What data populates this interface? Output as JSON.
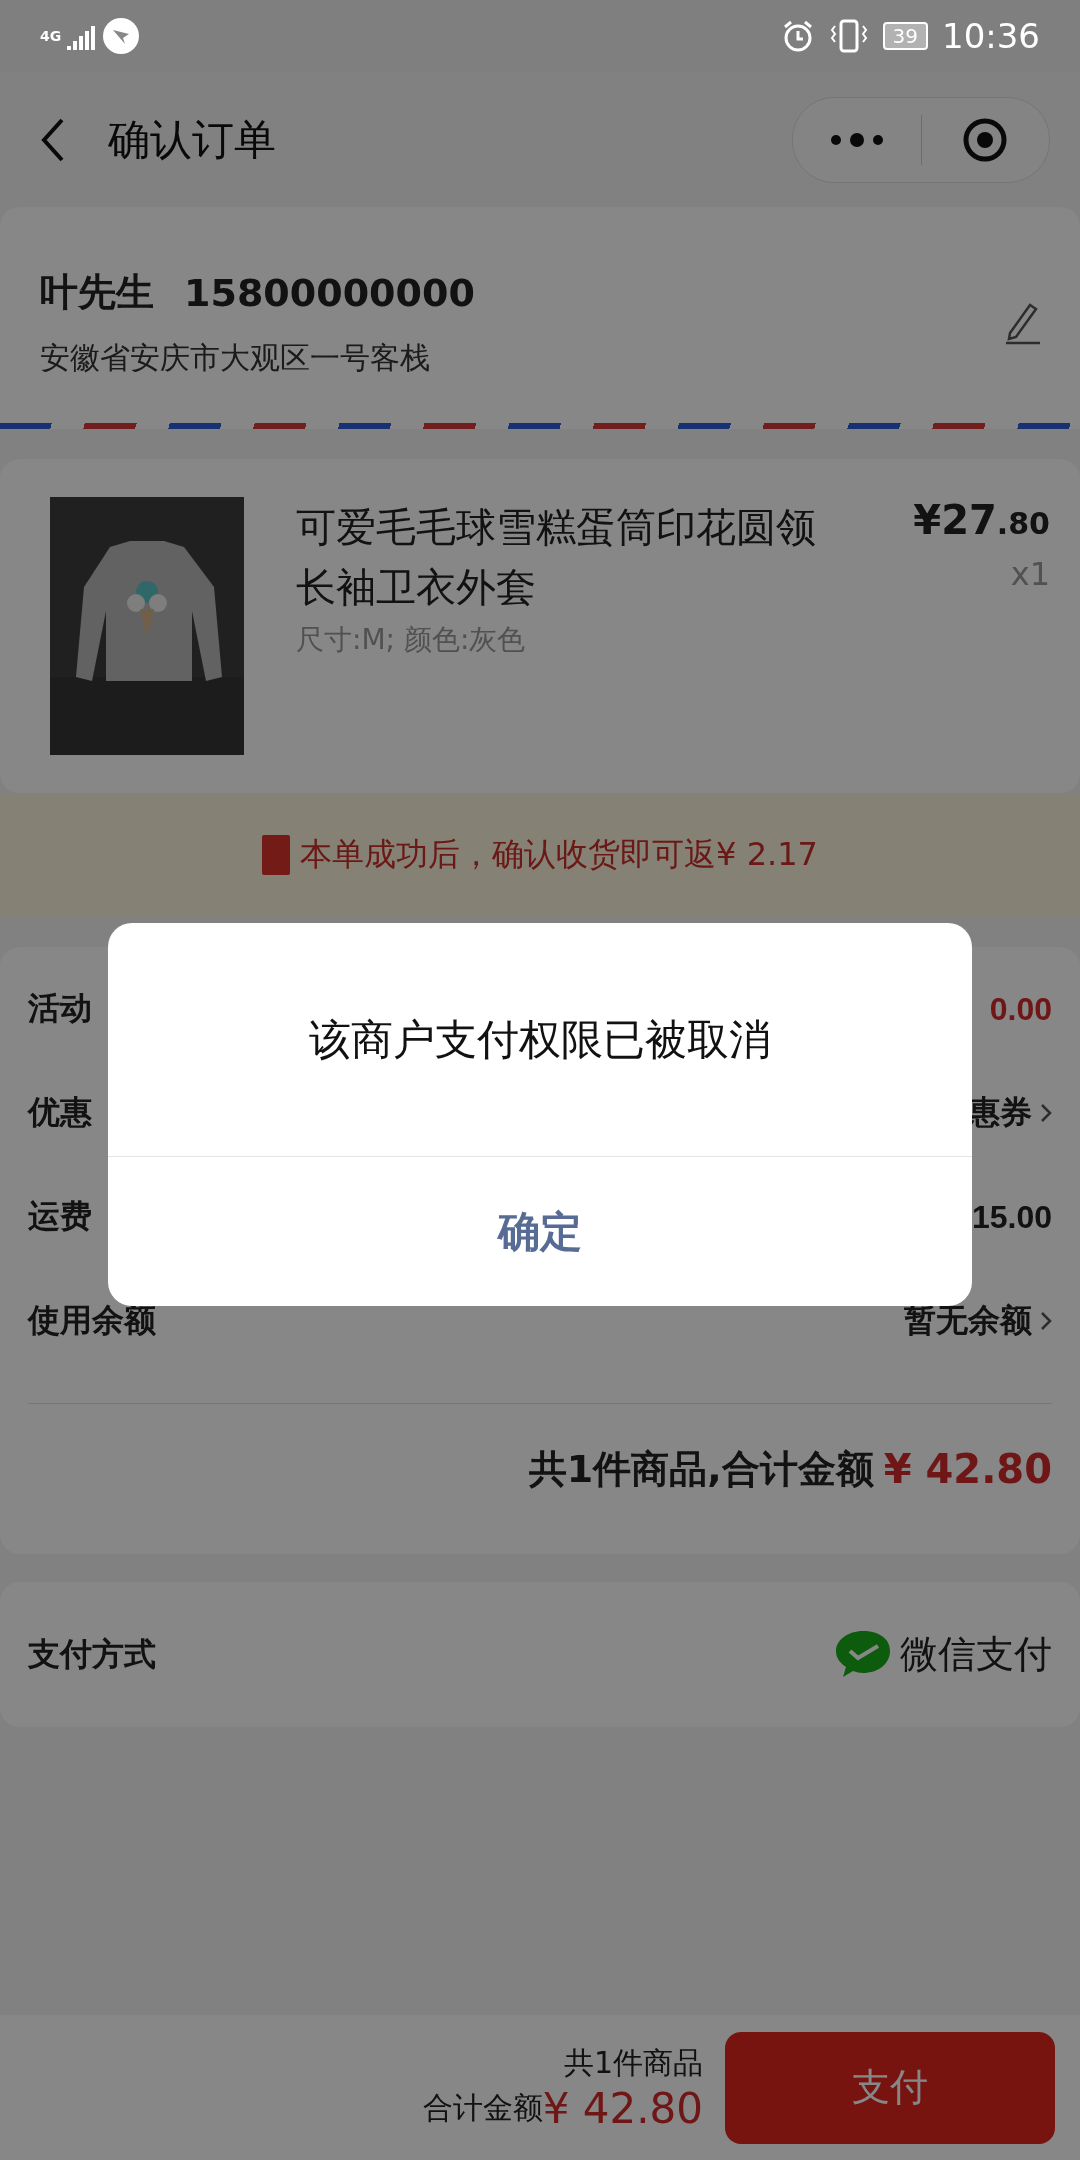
{
  "status_bar": {
    "network": "4G",
    "battery": "39",
    "time": "10:36"
  },
  "header": {
    "title": "确认订单"
  },
  "address": {
    "name": "叶先生",
    "phone": "15800000000",
    "address": "安徽省安庆市大观区一号客栈"
  },
  "product": {
    "title": "可爱毛毛球雪糕蛋筒印花圆领长袖卫衣外套",
    "specs": "尺寸:M; 颜色:灰色",
    "price": "¥27",
    "price_decimal": ".80",
    "quantity": "x1"
  },
  "rebate": {
    "text": "本单成功后，确认收货即可返¥ 2.17"
  },
  "summary": {
    "rows": [
      {
        "label": "活动",
        "value": "0.00",
        "accent": true,
        "chevron": false
      },
      {
        "label": "优惠",
        "value": "惠券",
        "accent": false,
        "chevron": true
      },
      {
        "label": "运费",
        "value": "15.00",
        "accent": false,
        "chevron": false
      },
      {
        "label": "使用余额",
        "value": "暂无余额",
        "accent": false,
        "chevron": true
      }
    ],
    "total_label": "共1件商品,合计金额",
    "total_amount": "¥ 42.80"
  },
  "payment": {
    "label": "支付方式",
    "method": "微信支付"
  },
  "footer": {
    "count": "共1件商品",
    "label": "合计金额",
    "amount": "¥ 42.80",
    "button": "支付"
  },
  "dialog": {
    "message": "该商户支付权限已被取消",
    "button": "确定"
  }
}
